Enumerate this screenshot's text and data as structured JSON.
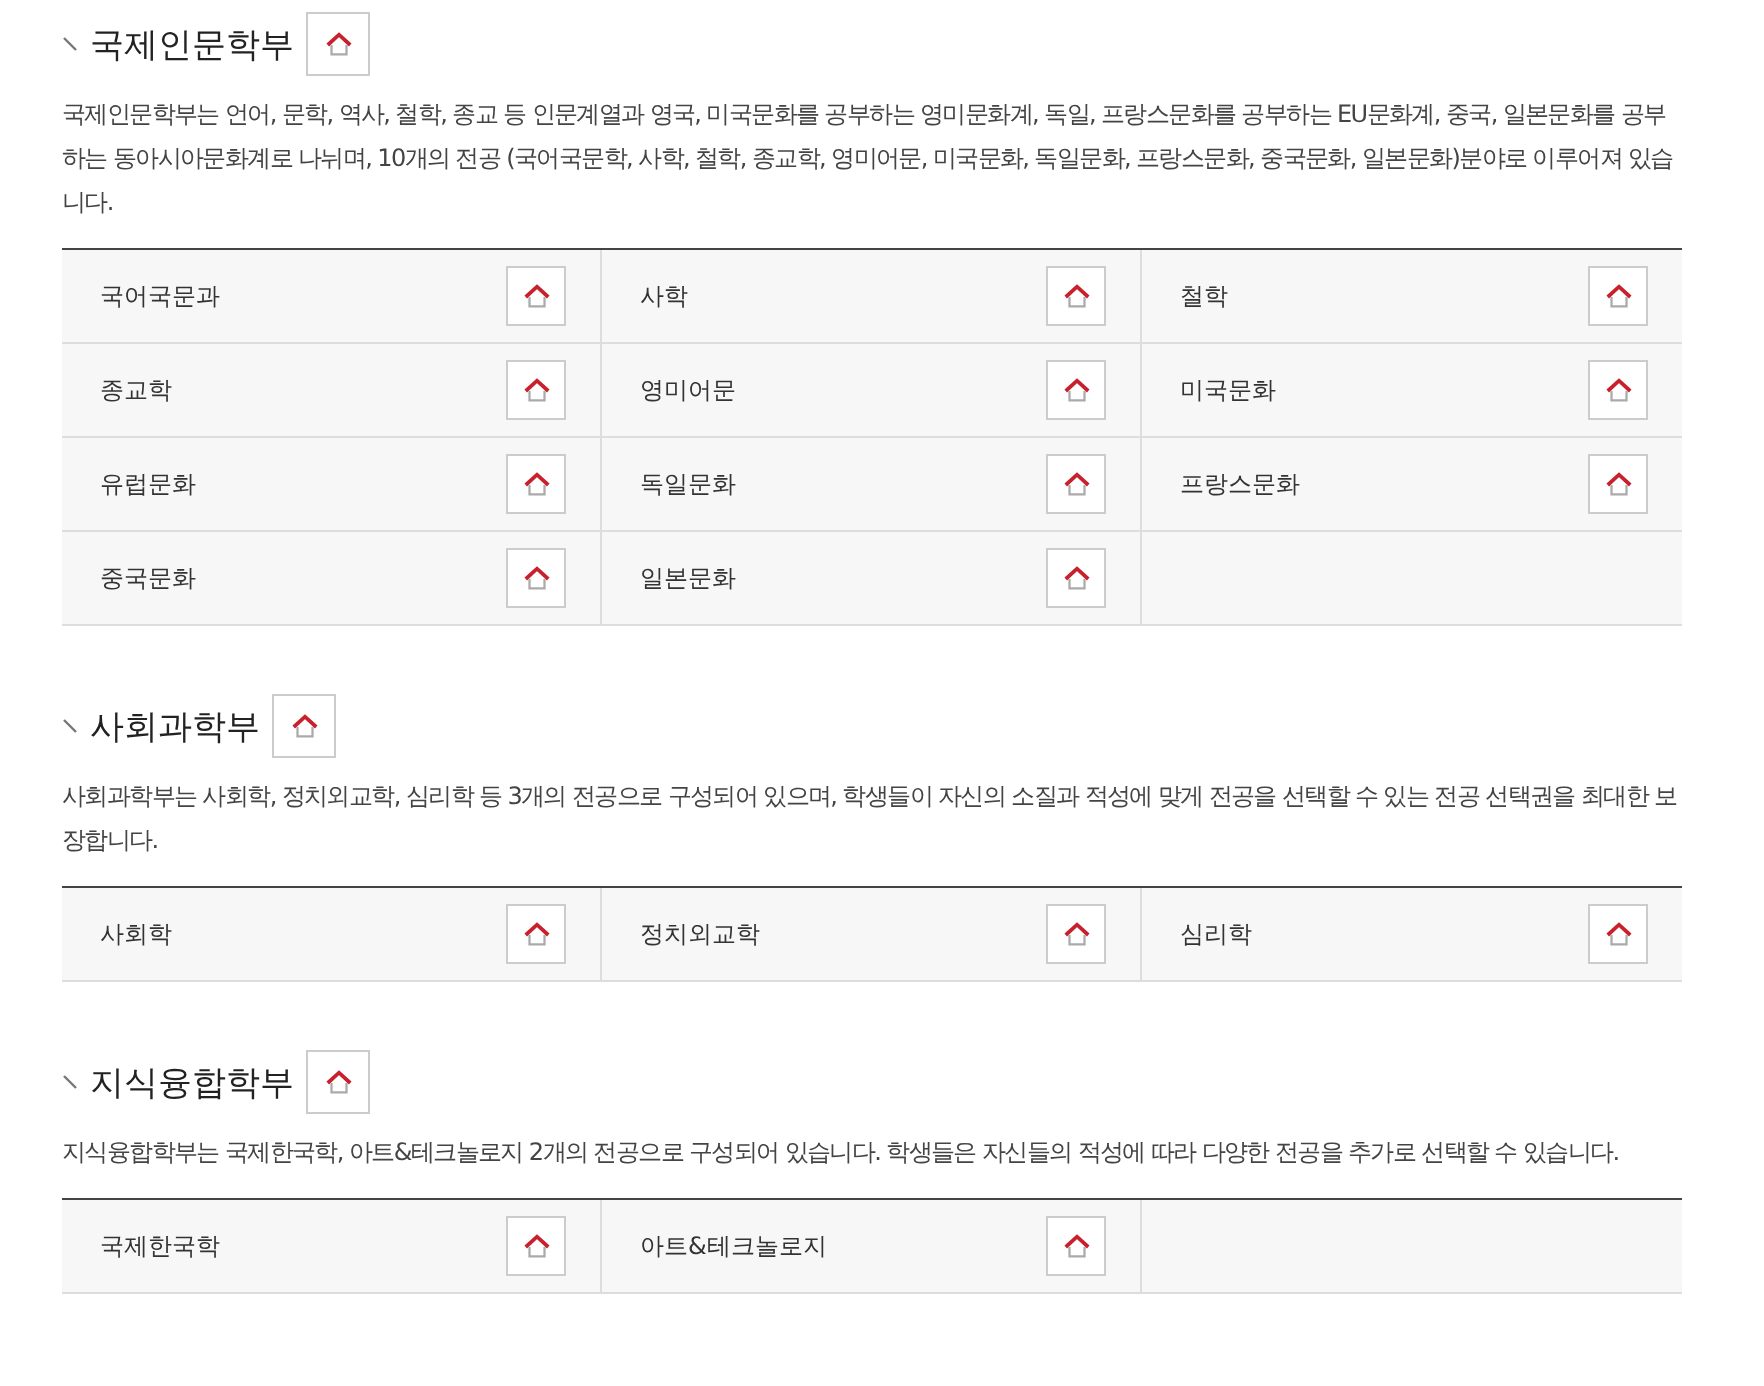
{
  "sections": [
    {
      "title": "국제인문학부",
      "description": "국제인문학부는 언어, 문학, 역사, 철학, 종교 등 인문계열과 영국, 미국문화를 공부하는 영미문화계, 독일, 프랑스문화를 공부하는 EU문화계, 중국, 일본문화를 공부하는 동아시아문화계로 나뉘며, 10개의 전공 (국어국문학, 사학, 철학, 종교학, 영미어문, 미국문화, 독일문화, 프랑스문화, 중국문화, 일본문화)분야로 이루어져 있습니다.",
      "majors": [
        "국어국문과",
        "사학",
        "철학",
        "종교학",
        "영미어문",
        "미국문화",
        "유럽문화",
        "독일문화",
        "프랑스문화",
        "중국문화",
        "일본문화"
      ]
    },
    {
      "title": "사회과학부",
      "description": "사회과학부는 사회학, 정치외교학, 심리학 등 3개의 전공으로 구성되어 있으며, 학생들이 자신의 소질과 적성에 맞게 전공을 선택할 수 있는 전공 선택권을 최대한 보장합니다.",
      "majors": [
        "사회학",
        "정치외교학",
        "심리학"
      ]
    },
    {
      "title": "지식융합학부",
      "description": "지식융합학부는 국제한국학, 아트&테크놀로지 2개의 전공으로 구성되어 있습니다. 학생들은 자신들의 적성에 따라 다양한 전공을 추가로 선택할 수 있습니다.",
      "majors": [
        "국제한국학",
        "아트&테크놀로지"
      ]
    }
  ]
}
